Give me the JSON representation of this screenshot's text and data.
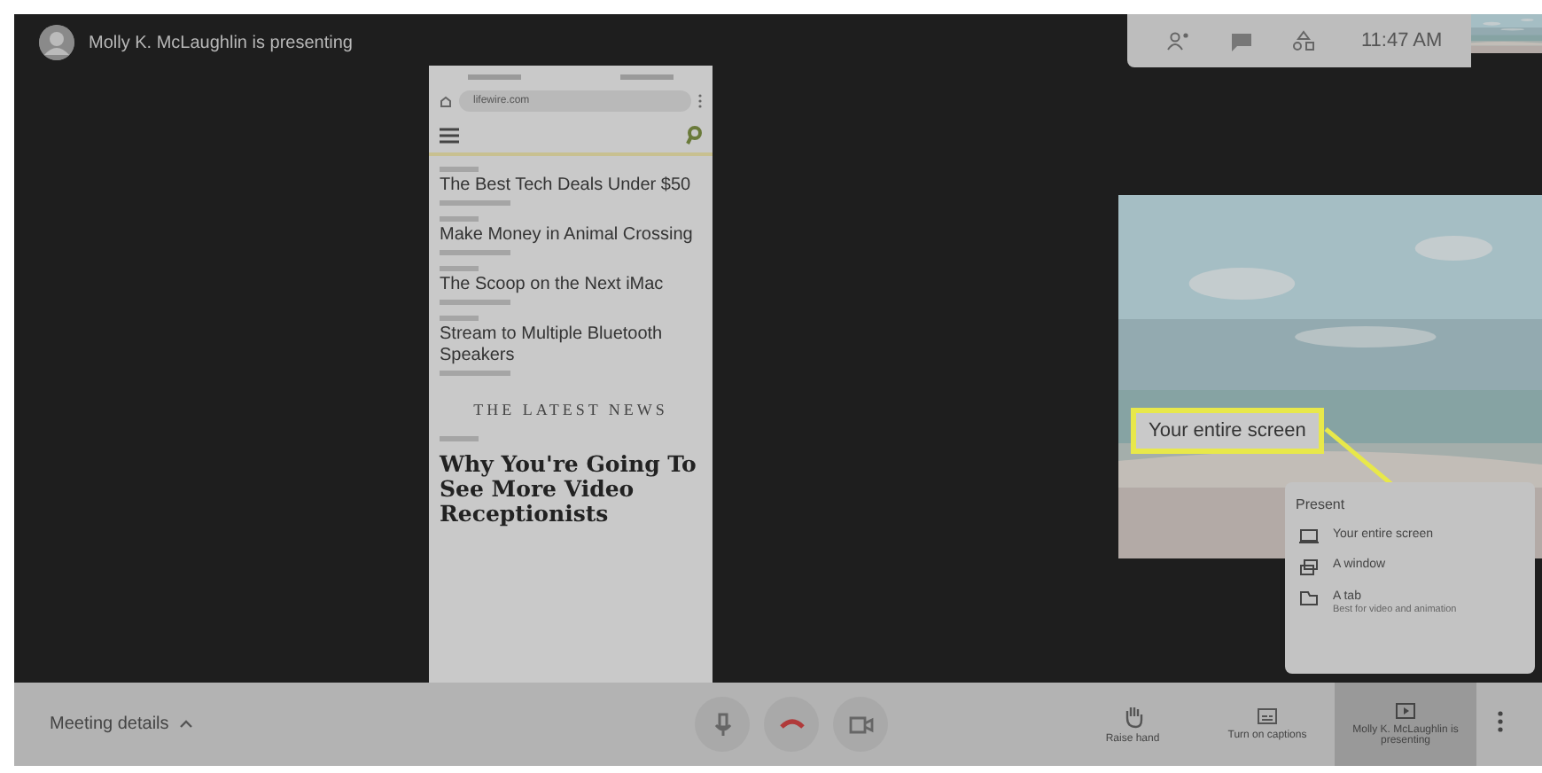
{
  "top_bar": {
    "presenter_label": "Molly K. McLaughlin is presenting",
    "time": "11:47 AM"
  },
  "shared_screen": {
    "url": "lifewire.com",
    "articles": [
      {
        "headline": "The Best Tech Deals Under $50"
      },
      {
        "headline": "Make Money in Animal Crossing"
      },
      {
        "headline": "The Scoop on the Next iMac"
      },
      {
        "headline": "Stream to Multiple Bluetooth Speakers"
      }
    ],
    "section_title": "THE LATEST NEWS",
    "feature_headline": "Why You're Going To See More Video Receptionists"
  },
  "callout": {
    "text": "Your entire screen"
  },
  "present_menu": {
    "title": "Present",
    "items": [
      {
        "kind": "screen",
        "label": "Your entire screen"
      },
      {
        "kind": "window",
        "label": "A window"
      },
      {
        "kind": "tab",
        "label": "A tab",
        "hint": "Best for video and animation"
      }
    ]
  },
  "bottom_bar": {
    "meeting_details": "Meeting details",
    "call_controls": [
      {
        "kind": "mic"
      },
      {
        "kind": "hangup"
      },
      {
        "kind": "camera"
      }
    ],
    "actions": [
      {
        "kind": "hand",
        "label": "Raise hand",
        "selected": false
      },
      {
        "kind": "captions",
        "label": "Turn on captions",
        "selected": false
      },
      {
        "kind": "present",
        "label": "Molly K. McLaughlin is presenting",
        "selected": true
      }
    ]
  }
}
